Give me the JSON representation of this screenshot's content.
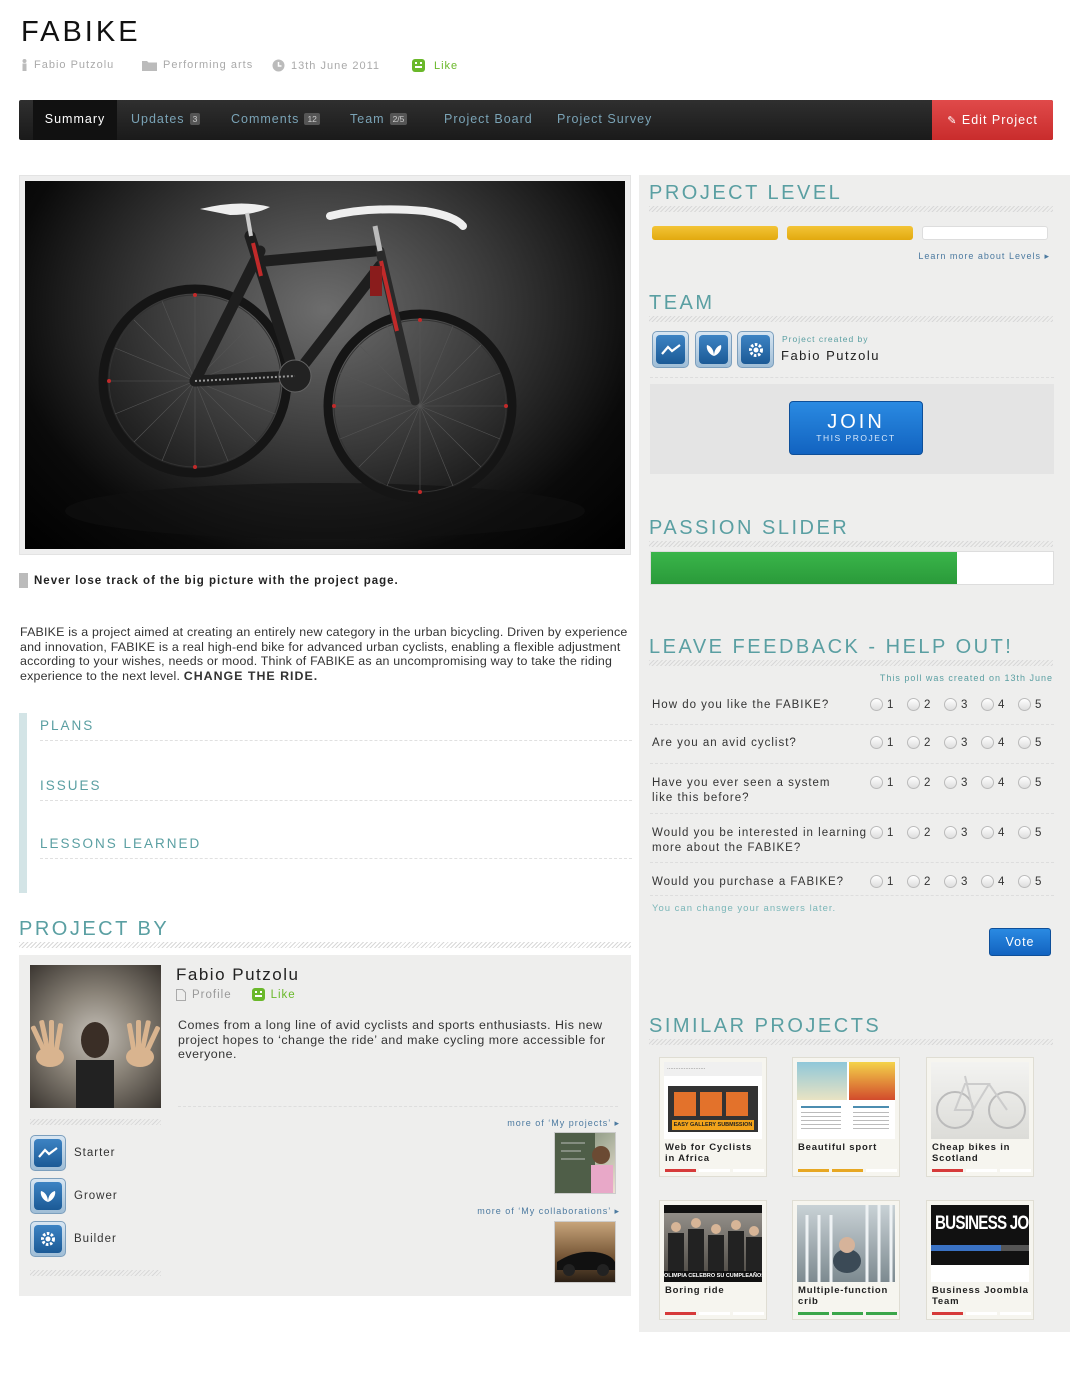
{
  "project": {
    "title": "FABIKE",
    "author": "Fabio Putzolu",
    "category": "Performing arts",
    "date": "13th June 2011",
    "like_label": "Like"
  },
  "nav": {
    "tabs": [
      {
        "label": "Summary",
        "badge": ""
      },
      {
        "label": "Updates",
        "badge": "3"
      },
      {
        "label": "Comments",
        "badge": "12"
      },
      {
        "label": "Team",
        "badge": "2/5"
      },
      {
        "label": "Project Board",
        "badge": ""
      },
      {
        "label": "Project Survey",
        "badge": ""
      }
    ],
    "active_tab": "Summary",
    "edit_label": "Edit Project"
  },
  "summary": {
    "tagline": "Never lose track of the big picture with the project page.",
    "description": "FABIKE is a project aimed at creating an entirely new category in the urban bicycling. Driven by experience and innovation, FABIKE is a real high-end bike for advanced urban cyclists, enabling a flexible adjustment according to your wishes, needs or mood. Think of FABIKE as an uncompromising way to take the riding experience to the next level.",
    "description_emphasis": "CHANGE THE RIDE.",
    "sections": [
      "PLANS",
      "ISSUES",
      "LESSONS LEARNED"
    ]
  },
  "project_by": {
    "heading": "PROJECT BY",
    "name": "Fabio Putzolu",
    "profile_label": "Profile",
    "like_label": "Like",
    "bio": "Comes from a long line of avid cyclists and sports enthusiasts. His new project hopes to ‘change the ride’ and make cycling more accessible for everyone.",
    "roles": [
      "Starter",
      "Grower",
      "Builder"
    ],
    "more_projects": "more of ‘My projects’",
    "more_collabs": "more of ‘My collaborations’"
  },
  "level": {
    "heading": "PROJECT LEVEL",
    "levels_filled": 2,
    "levels_total": 3,
    "learn_more": "Learn more about Levels"
  },
  "team": {
    "heading": "TEAM",
    "created_by_label": "Project created by",
    "creator": "Fabio Putzolu",
    "join_label": "JOIN",
    "join_sub": "THIS PROJECT"
  },
  "passion": {
    "heading": "PASSION SLIDER",
    "value": 0.76
  },
  "feedback": {
    "heading": "LEAVE FEEDBACK - HELP OUT!",
    "created_note": "This poll was created on 13th June",
    "questions": [
      "How do you like the FABIKE?",
      "Are you an avid cyclist?",
      "Have you ever seen a system like this before?",
      "Would you be interested in learning more about the FABIKE?",
      "Would you purchase a FABIKE?"
    ],
    "options": [
      "1",
      "2",
      "3",
      "4",
      "5"
    ],
    "change_note": "You can change your answers later.",
    "vote_label": "Vote"
  },
  "similar": {
    "heading": "SIMILAR PROJECTS",
    "items": [
      {
        "title": "Web for Cyclists in Africa",
        "level": 1,
        "level_color": "#d63a3a",
        "thumb_text": "EASY GALLERY SUBMISSION"
      },
      {
        "title": "Beautiful sport",
        "level": 2,
        "level_color": "#e7a722",
        "thumb_text": ""
      },
      {
        "title": "Cheap bikes in Scotland",
        "level": 1,
        "level_color": "#d63a3a",
        "thumb_text": ""
      },
      {
        "title": "Boring ride",
        "level": 1,
        "level_color": "#d63a3a",
        "thumb_text": "OLIMPIA CELEBRO SU CUMPLEAÑOS"
      },
      {
        "title": "Multiple-function crib",
        "level": 3,
        "level_color": "#3aa64a",
        "thumb_text": ""
      },
      {
        "title": "Business Joombla Team",
        "level": 1,
        "level_color": "#d63a3a",
        "thumb_text": "BUSINESS JO"
      }
    ]
  }
}
